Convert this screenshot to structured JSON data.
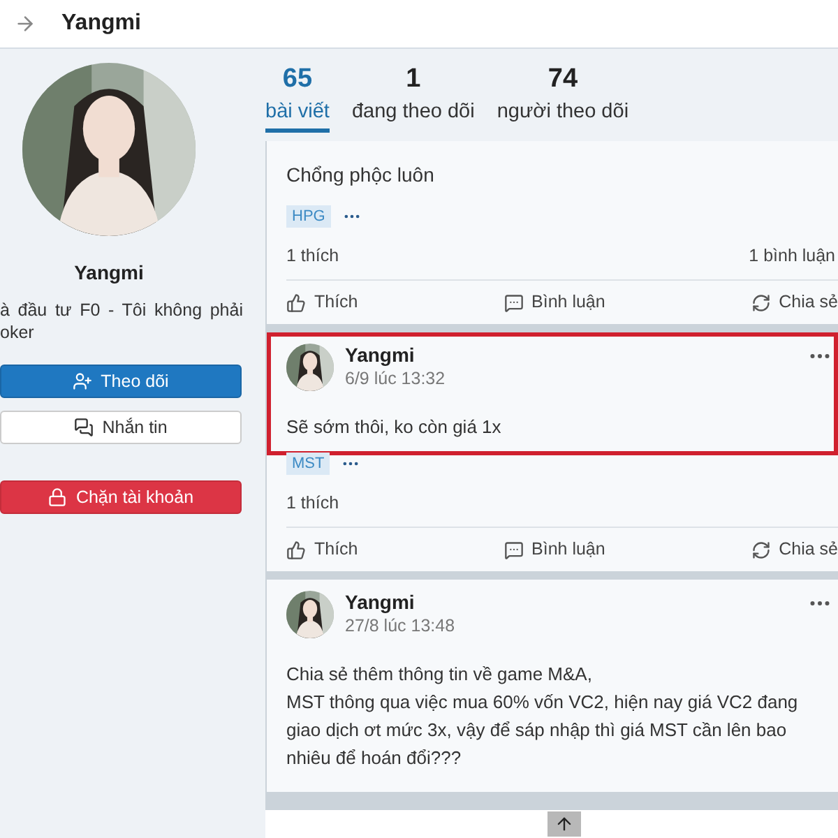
{
  "header": {
    "title": "Yangmi"
  },
  "profile": {
    "name": "Yangmi",
    "bio": "à đầu tư F0 - Tôi không phải oker",
    "buttons": [
      {
        "label": "Theo dõi",
        "kind": "follow"
      },
      {
        "label": "Nhắn tin",
        "kind": "message"
      },
      {
        "label": "Chặn tài khoản",
        "kind": "block"
      }
    ]
  },
  "stats": [
    {
      "count": "65",
      "label": "bài viết",
      "selected": true
    },
    {
      "count": "1",
      "label": "đang theo dõi",
      "selected": false
    },
    {
      "count": "74",
      "label": "người theo dõi",
      "selected": false
    }
  ],
  "posts": [
    {
      "content": "Chổng phộc luôn",
      "tags": [
        "HPG"
      ],
      "likes": "1 thích",
      "comments": "1 bình luận",
      "actions": [
        "Thích",
        "Bình luận",
        "Chia sẻ"
      ]
    },
    {
      "author": "Yangmi",
      "time": "6/9 lúc 13:32",
      "content": "Sẽ sớm thôi, ko còn giá 1x",
      "tags": [
        "MST"
      ],
      "likes": "1 thích",
      "highlighted": true,
      "actions": [
        "Thích",
        "Bình luận",
        "Chia sẻ"
      ]
    },
    {
      "author": "Yangmi",
      "time": "27/8 lúc 13:48",
      "content": "Chia sẻ thêm thông tin về game M&A,\nMST thông qua việc mua 60% vốn VC2, hiện nay giá VC2 đang giao dịch ơt mức 3x, vậy để sáp nhập thì giá MST cần lên bao nhiêu để hoán đổi???"
    }
  ]
}
